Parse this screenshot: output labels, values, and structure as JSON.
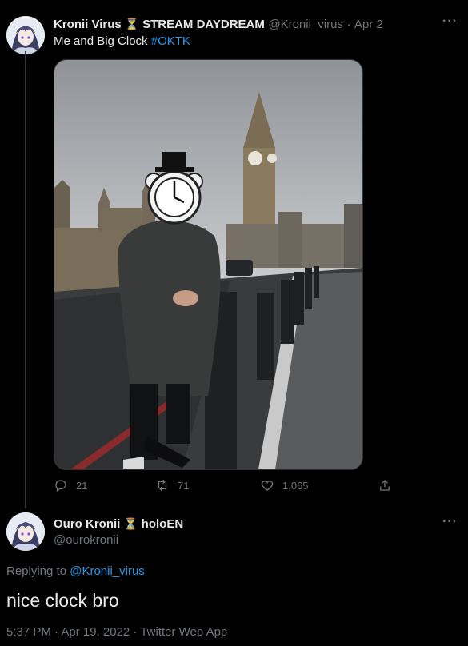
{
  "tweet": {
    "author_name": "Kronii Virus",
    "hourglass": "⏳",
    "author_suffix": "STREAM DAYDREAM",
    "handle": "@Kronii_virus",
    "separator": "·",
    "date": "Apr 2",
    "text": "Me and Big Clock",
    "hashtag": "#OKTK",
    "replies": "21",
    "retweets": "71",
    "likes": "1,065"
  },
  "reply": {
    "author_name": "Ouro Kronii",
    "hourglass": "⏳",
    "author_suffix": "holoEN",
    "handle": "@ourokronii",
    "replying_prefix": "Replying to",
    "replying_to": "@Kronii_virus",
    "text": "nice clock bro",
    "timestamp": "5:37 PM · Apr 19, 2022 · Twitter Web App"
  },
  "icons": {
    "more": "more-icon",
    "reply": "reply-icon",
    "retweet": "retweet-icon",
    "like": "heart-icon",
    "share": "share-icon"
  },
  "colors": {
    "background": "#000000",
    "text": "#e7e9ea",
    "muted": "#71767b",
    "link": "#1d9bf0"
  }
}
